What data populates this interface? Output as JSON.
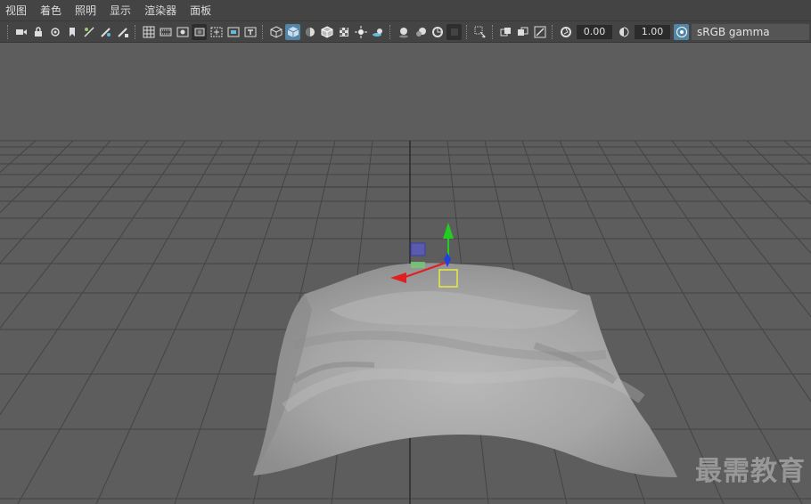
{
  "menubar": {
    "items": [
      {
        "label": "视图"
      },
      {
        "label": "着色"
      },
      {
        "label": "照明"
      },
      {
        "label": "显示"
      },
      {
        "label": "渲染器"
      },
      {
        "label": "面板"
      }
    ]
  },
  "toolbar": {
    "exposure_value": "0.00",
    "gamma_value": "1.00",
    "color_management": "sRGB gamma",
    "colors": {
      "active": "#5285a6",
      "bar": "#444444"
    }
  },
  "viewport": {
    "background": "#5d5d5d",
    "grid_color": "#3e3e3e",
    "manipulator": {
      "x_axis": "#e02020",
      "y_axis": "#22cc22",
      "z_axis": "#2040e0",
      "pivot": "#e8e840"
    }
  },
  "watermark": {
    "text": "最需教育"
  }
}
